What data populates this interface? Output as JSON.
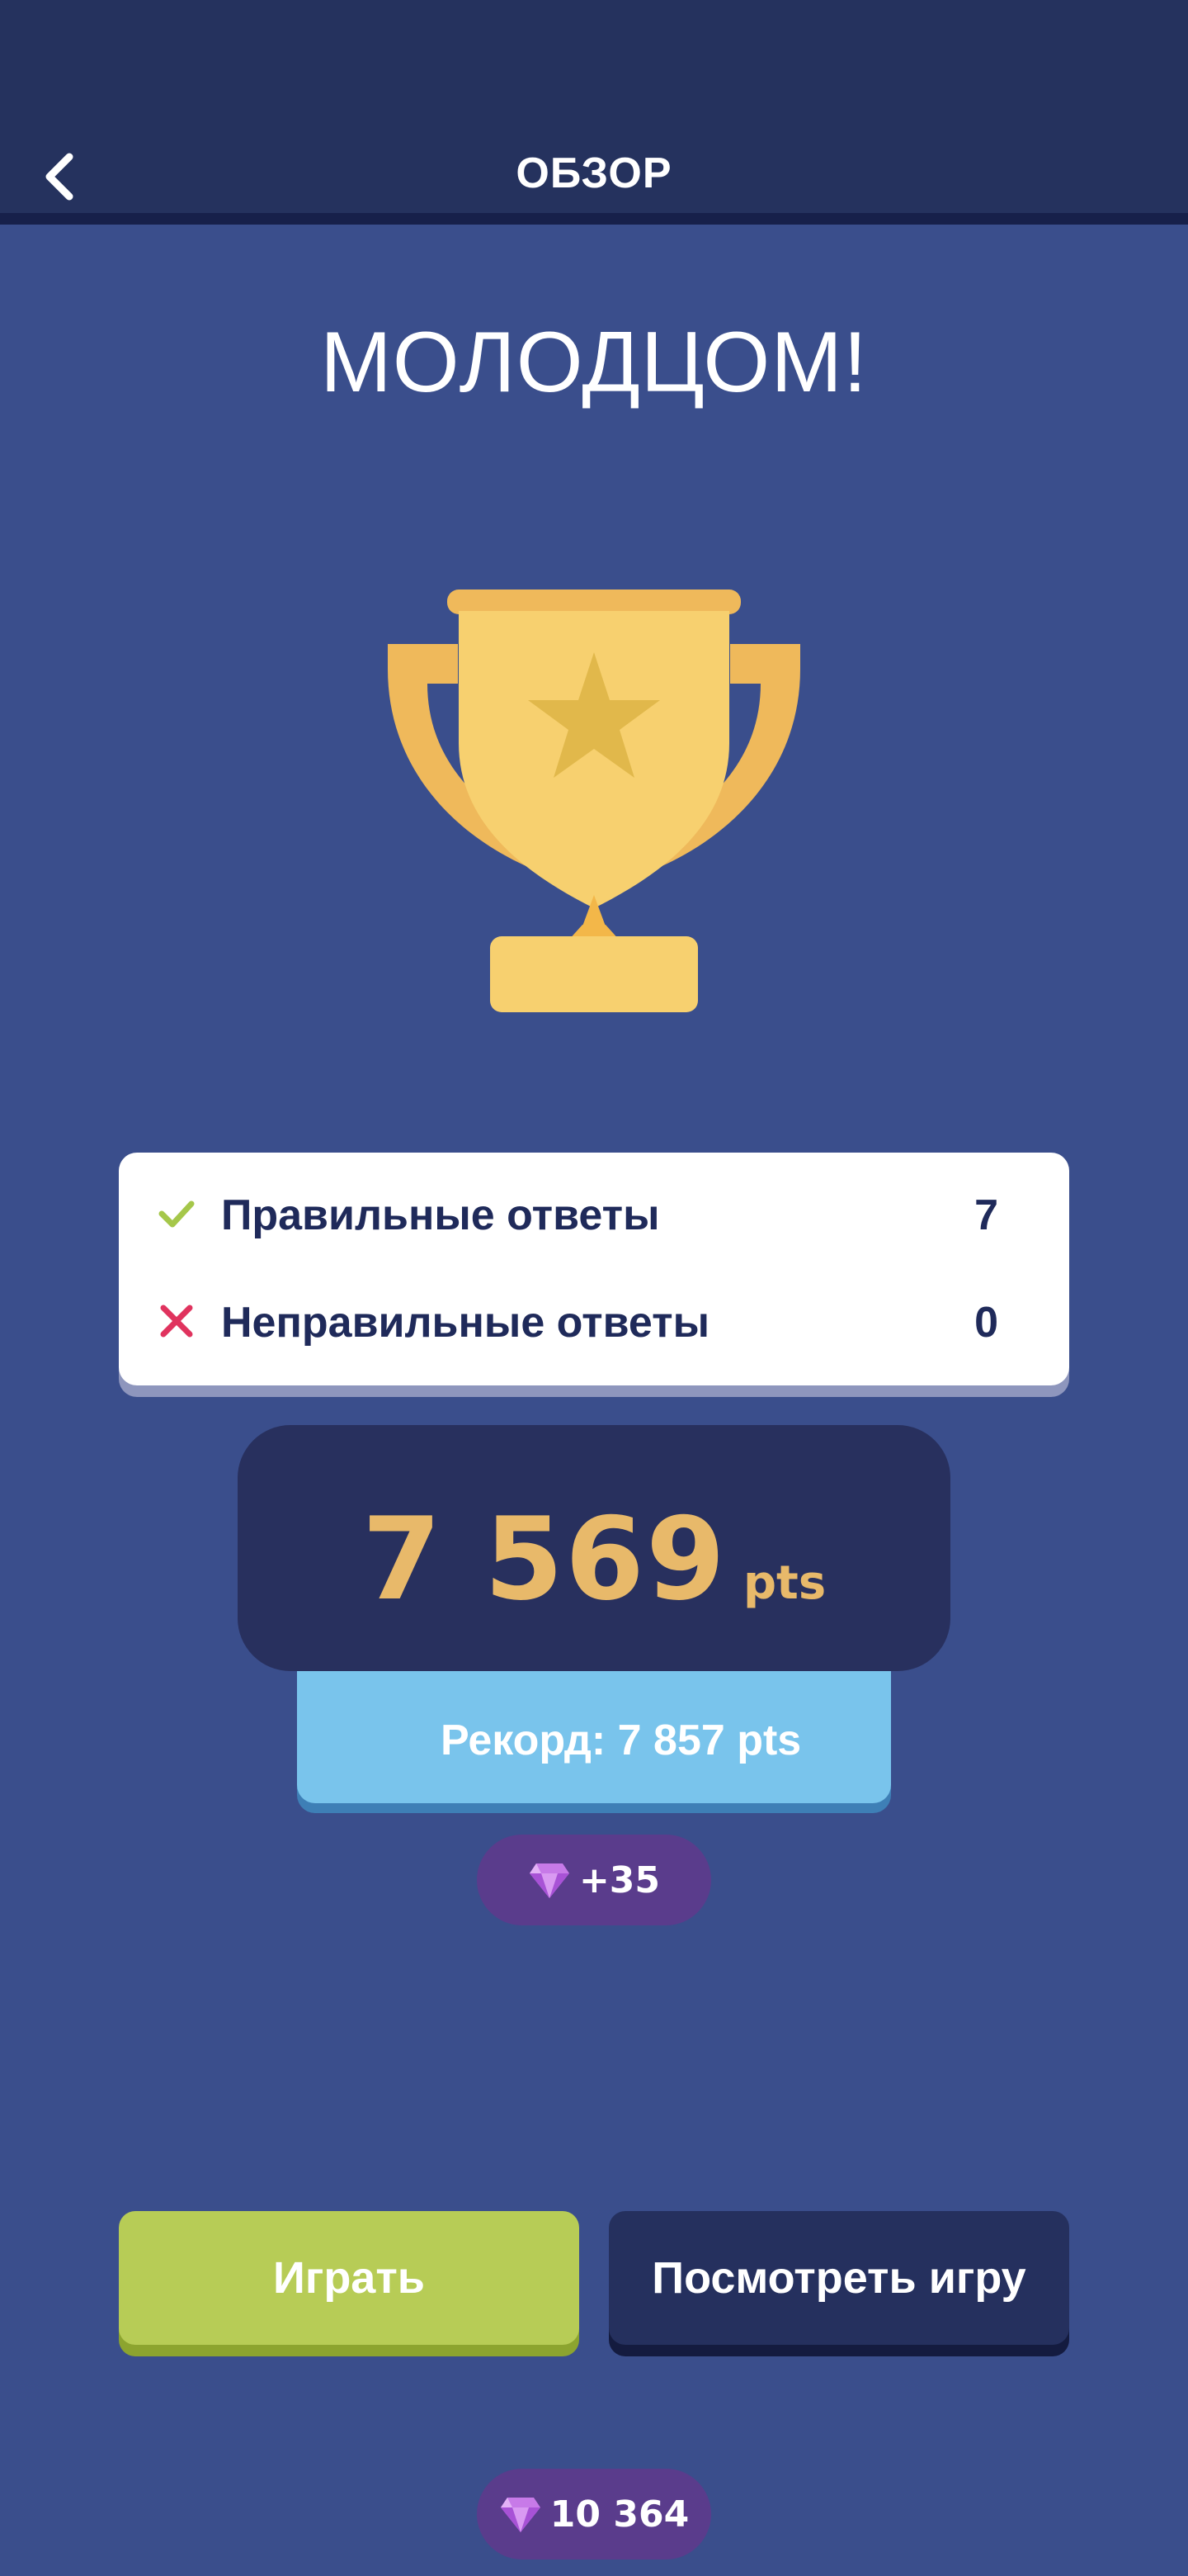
{
  "header": {
    "title": "ОБЗОР",
    "back_icon": "chevron-left-icon"
  },
  "headline": "МОЛОДЦОМ!",
  "trophy_icon": "trophy-icon",
  "results": {
    "correct": {
      "icon": "check-icon",
      "label": "Правильные ответы",
      "value": "7"
    },
    "wrong": {
      "icon": "cross-icon",
      "label": "Неправильные ответы",
      "value": "0"
    }
  },
  "score": {
    "value": "7 569",
    "unit": "pts"
  },
  "record": {
    "label": "Рекорд: 7 857 pts"
  },
  "gems_earned": {
    "icon": "gem-icon",
    "text": "+35"
  },
  "buttons": {
    "play": "Играть",
    "review": "Посмотреть игру"
  },
  "gems_total": {
    "icon": "gem-icon",
    "text": "10 364"
  },
  "colors": {
    "background": "#3a4e8c",
    "header": "#25325e",
    "accent_gold": "#e8b96a",
    "play_button": "#b7cc56",
    "record_blue": "#79c4ec",
    "gem_pill": "#5a3c8c"
  }
}
